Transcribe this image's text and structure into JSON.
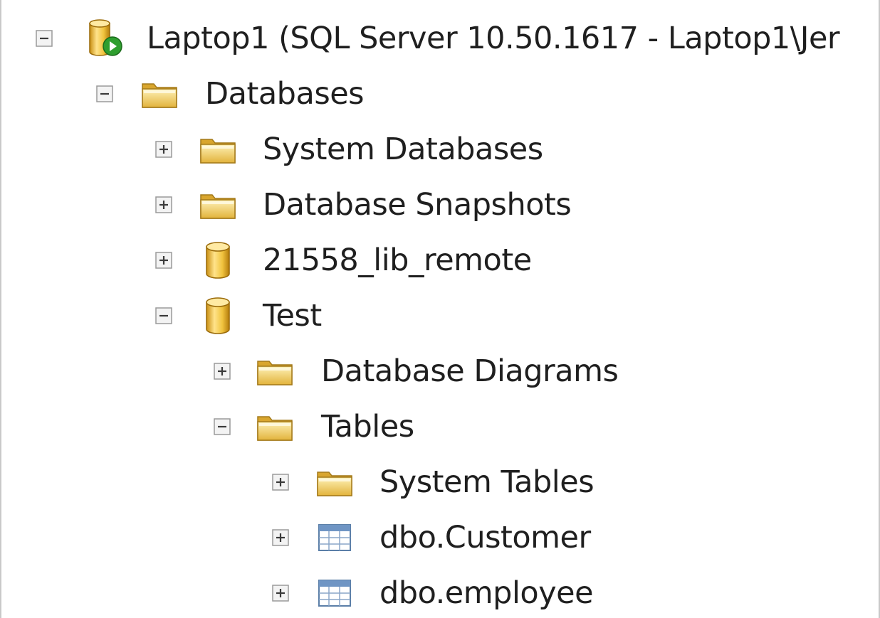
{
  "tree": {
    "nodes": [
      {
        "level": 0,
        "icon": "server-icon",
        "expanded": true,
        "label": "Laptop1 (SQL Server 10.50.1617 - Laptop1\\Jer"
      },
      {
        "level": 1,
        "icon": "folder-icon",
        "expanded": true,
        "label": "Databases"
      },
      {
        "level": 2,
        "icon": "folder-icon",
        "expanded": false,
        "label": "System Databases"
      },
      {
        "level": 2,
        "icon": "folder-icon",
        "expanded": false,
        "label": "Database Snapshots"
      },
      {
        "level": 2,
        "icon": "database-icon",
        "expanded": false,
        "label": "21558_lib_remote"
      },
      {
        "level": 2,
        "icon": "database-icon",
        "expanded": true,
        "label": "Test"
      },
      {
        "level": 3,
        "icon": "folder-icon",
        "expanded": false,
        "label": "Database Diagrams"
      },
      {
        "level": 3,
        "icon": "folder-icon",
        "expanded": true,
        "label": "Tables"
      },
      {
        "level": 4,
        "icon": "folder-icon",
        "expanded": false,
        "label": "System Tables"
      },
      {
        "level": 4,
        "icon": "table-icon",
        "expanded": false,
        "label": "dbo.Customer"
      },
      {
        "level": 4,
        "icon": "table-icon",
        "expanded": false,
        "label": "dbo.employee"
      }
    ]
  }
}
